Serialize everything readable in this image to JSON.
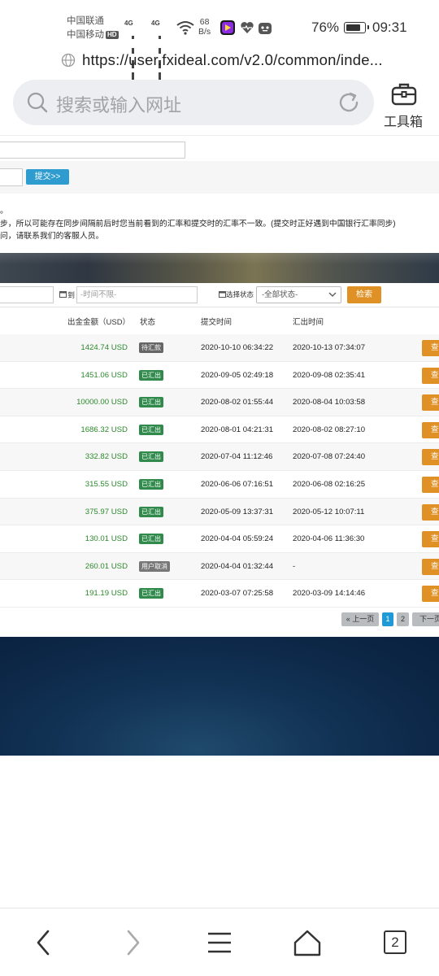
{
  "status_bar": {
    "carrier1": "中国联通",
    "carrier2": "中国移动",
    "hd": "HD",
    "net1": "4G",
    "net2": "4G",
    "speed_value": "68",
    "speed_unit": "B/s",
    "battery_pct": "76%",
    "battery_level": 0.76,
    "time": "09:31"
  },
  "browser": {
    "url": "https://user.fxideal.com/v2.0/common/inde...",
    "search_placeholder": "搜索或输入网址",
    "toolbox_label": "工具箱",
    "tab_count": "2"
  },
  "form": {
    "submit_label": "提交>>",
    "notes": [
      "。",
      "步，所以可能存在同步间隔前后时您当前看到的汇率和提交时的汇率不一致。(提交时正好遇到中国银行汇率同步)",
      "问，请联系我们的客服人员。"
    ]
  },
  "filter": {
    "to_label": "到",
    "time_placeholder": "-时间不限-",
    "status_label": "选择状态",
    "status_value": "-全部状态-",
    "search_label": "检索"
  },
  "table": {
    "headers": {
      "amount": "出金金额（USD）",
      "status": "状态",
      "submit_time": "提交时间",
      "out_time": "汇出时间"
    },
    "view_label": "查",
    "rows": [
      {
        "amount": "1424.74 USD",
        "status": "待汇款",
        "status_type": "wait",
        "submit": "2020-10-10 06:34:22",
        "out": "2020-10-13 07:34:07"
      },
      {
        "amount": "1451.06 USD",
        "status": "已汇出",
        "status_type": "done",
        "submit": "2020-09-05 02:49:18",
        "out": "2020-09-08 02:35:41"
      },
      {
        "amount": "10000.00 USD",
        "status": "已汇出",
        "status_type": "done",
        "submit": "2020-08-02 01:55:44",
        "out": "2020-08-04 10:03:58"
      },
      {
        "amount": "1686.32 USD",
        "status": "已汇出",
        "status_type": "done",
        "submit": "2020-08-01 04:21:31",
        "out": "2020-08-02 08:27:10"
      },
      {
        "amount": "332.82 USD",
        "status": "已汇出",
        "status_type": "done",
        "submit": "2020-07-04 11:12:46",
        "out": "2020-07-08 07:24:40"
      },
      {
        "amount": "315.55 USD",
        "status": "已汇出",
        "status_type": "done",
        "submit": "2020-06-06 07:16:51",
        "out": "2020-06-08 02:16:25"
      },
      {
        "amount": "375.97 USD",
        "status": "已汇出",
        "status_type": "done",
        "submit": "2020-05-09 13:37:31",
        "out": "2020-05-12 10:07:11"
      },
      {
        "amount": "130.01 USD",
        "status": "已汇出",
        "status_type": "done",
        "submit": "2020-04-04 05:59:24",
        "out": "2020-04-06 11:36:30"
      },
      {
        "amount": "260.01 USD",
        "status": "用户取消",
        "status_type": "cancel",
        "submit": "2020-04-04 01:32:44",
        "out": "-"
      },
      {
        "amount": "191.19 USD",
        "status": "已汇出",
        "status_type": "done",
        "submit": "2020-03-07 07:25:58",
        "out": "2020-03-09 14:14:46"
      }
    ]
  },
  "pager": {
    "prev": "« 上一页",
    "pages": [
      "1",
      "2"
    ],
    "next": "下一页"
  },
  "colors": {
    "accent_orange": "#e09126",
    "accent_blue": "#2e9ccf",
    "amount_green": "#2c8a2c",
    "status_done": "#2f8a4c"
  }
}
